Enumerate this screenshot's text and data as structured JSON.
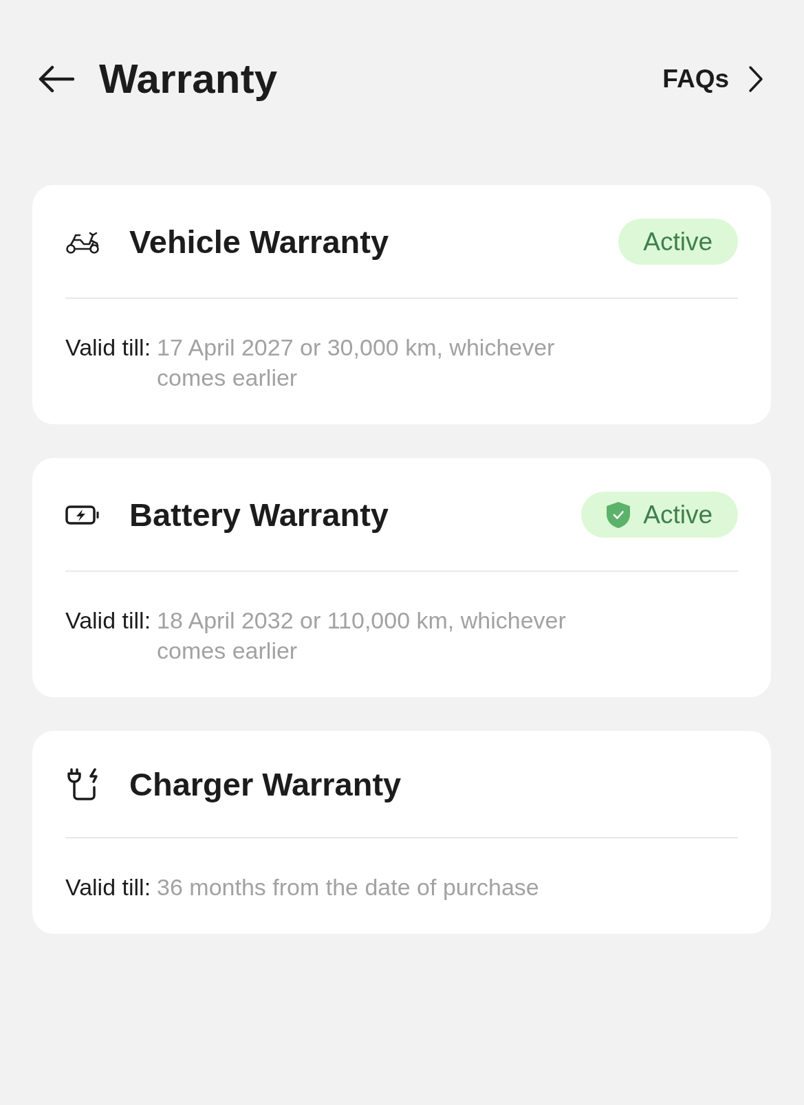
{
  "header": {
    "title": "Warranty",
    "link": "FAQs"
  },
  "warranties": [
    {
      "kind": "vehicle",
      "title": "Vehicle Warranty",
      "status": {
        "label": "Active",
        "shield": false
      },
      "label": "Valid till:",
      "value": "17 April 2027 or 30,000 km, whichever comes earlier"
    },
    {
      "kind": "battery",
      "title": "Battery Warranty",
      "status": {
        "label": "Active",
        "shield": true
      },
      "label": "Valid till:",
      "value": "18 April 2032 or 110,000 km, whichever comes earlier"
    },
    {
      "kind": "charger",
      "title": "Charger Warranty",
      "label": "Valid till:",
      "value": "36 months from the date of purchase"
    }
  ]
}
